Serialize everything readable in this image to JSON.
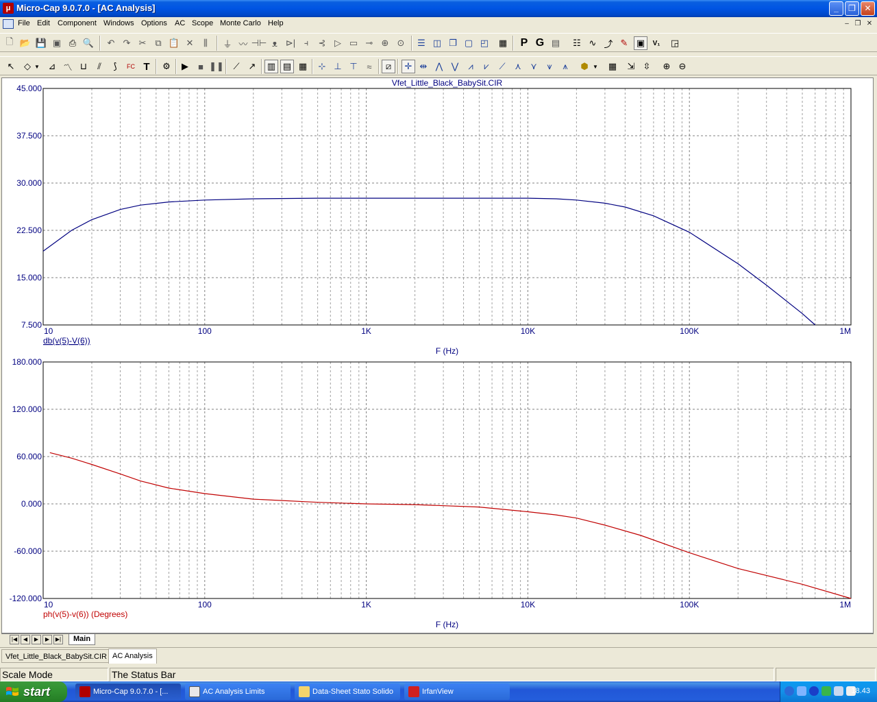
{
  "window": {
    "title": "Micro-Cap 9.0.7.0 - [AC Analysis]"
  },
  "menu": [
    "File",
    "Edit",
    "Component",
    "Windows",
    "Options",
    "AC",
    "Scope",
    "Monte Carlo",
    "Help"
  ],
  "plot": {
    "circuit_title": "Vfet_Little_Black_BabySit.CIR",
    "top": {
      "y_ticks": [
        "45.000",
        "37.500",
        "30.000",
        "22.500",
        "15.000",
        "7.500"
      ],
      "x_ticks": [
        "10",
        "100",
        "1K",
        "10K",
        "100K",
        "1M"
      ],
      "trace_label": "db(v(5)-V(6))",
      "x_label": "F (Hz)",
      "color": "#000080"
    },
    "bottom": {
      "y_ticks": [
        "180.000",
        "120.000",
        "60.000",
        "0.000",
        "-60.000",
        "-120.000"
      ],
      "x_ticks": [
        "10",
        "100",
        "1K",
        "10K",
        "100K",
        "1M"
      ],
      "trace_label": "ph(v(5)-v(6)) (Degrees)",
      "x_label": "F (Hz)",
      "color": "#c00000"
    }
  },
  "chart_data": [
    {
      "type": "line",
      "title": "Vfet_Little_Black_BabySit.CIR",
      "xlabel": "F (Hz)",
      "ylabel": "",
      "xscale": "log",
      "xlim": [
        10,
        1000000
      ],
      "ylim": [
        7.5,
        45
      ],
      "grid": true,
      "series": [
        {
          "name": "db(v(5)-V(6))",
          "x": [
            10,
            15,
            20,
            30,
            40,
            60,
            100,
            200,
            500,
            1000,
            2000,
            5000,
            10000,
            15000,
            20000,
            30000,
            40000,
            60000,
            100000,
            200000,
            300000,
            500000,
            600000
          ],
          "y": [
            19.2,
            22.5,
            24.2,
            25.8,
            26.5,
            27.0,
            27.3,
            27.5,
            27.6,
            27.6,
            27.6,
            27.6,
            27.6,
            27.5,
            27.3,
            26.8,
            26.2,
            24.8,
            22.2,
            17.2,
            13.8,
            9.3,
            7.5
          ]
        }
      ]
    },
    {
      "type": "line",
      "title": "",
      "xlabel": "F (Hz)",
      "ylabel": "",
      "xscale": "log",
      "xlim": [
        10,
        1000000
      ],
      "ylim": [
        -120,
        180
      ],
      "grid": true,
      "series": [
        {
          "name": "ph(v(5)-v(6)) (Degrees)",
          "x": [
            11,
            15,
            20,
            30,
            40,
            60,
            100,
            200,
            500,
            1000,
            2000,
            5000,
            10000,
            15000,
            20000,
            30000,
            50000,
            100000,
            200000,
            500000,
            1000000
          ],
          "y": [
            65,
            58,
            50,
            38,
            29,
            20,
            13,
            6,
            2,
            0,
            -1,
            -4,
            -10,
            -14,
            -18,
            -27,
            -40,
            -62,
            -82,
            -102,
            -120
          ]
        }
      ]
    }
  ],
  "tabstrip": {
    "main_tab": "Main"
  },
  "mdi_tabs": [
    "Vfet_Little_Black_BabySit.CIR",
    "AC Analysis"
  ],
  "status": {
    "left": "Scale Mode",
    "middle": "The Status Bar"
  },
  "taskbar": {
    "start": "start",
    "buttons": [
      "Micro-Cap 9.0.7.0 - [...",
      "AC Analysis Limits",
      "Data-Sheet Stato Solido",
      "IrfanView"
    ],
    "clock": "18.43"
  },
  "colors": {
    "title_blue": "#0054e3",
    "trace_blue": "#000080",
    "trace_red": "#c00000"
  }
}
